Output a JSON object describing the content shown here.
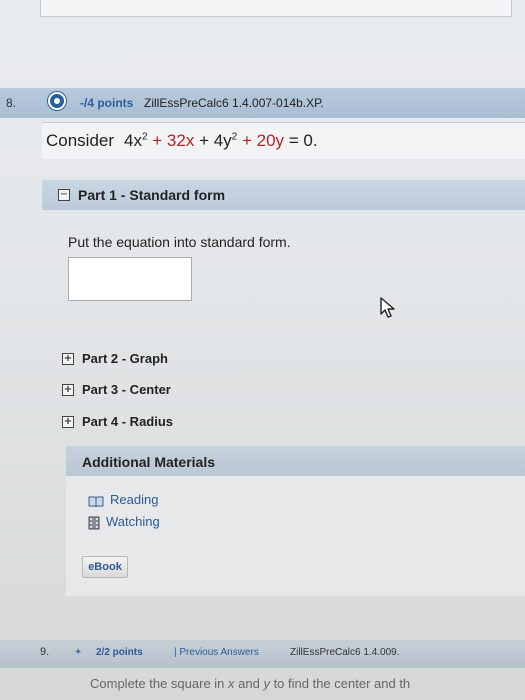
{
  "question": {
    "number": "8.",
    "points": "-/4 points",
    "problem_id": "ZillEssPreCalc6 1.4.007-014b.XP.",
    "consider_label": "Consider",
    "equation": {
      "t1": "4x",
      "t2": "+ 32x",
      "t3": "+ 4y",
      "t4": "+ 20y",
      "t5": "= 0."
    }
  },
  "part1": {
    "toggle": "−",
    "label": "Part 1 - Standard form",
    "instruction": "Put the equation into standard form.",
    "answer_value": ""
  },
  "parts": [
    {
      "toggle": "+",
      "label": "Part 2 - Graph"
    },
    {
      "toggle": "+",
      "label": "Part 3 - Center"
    },
    {
      "toggle": "+",
      "label": "Part 4 - Radius"
    }
  ],
  "additional": {
    "title": "Additional Materials",
    "links": [
      {
        "label": "Reading",
        "icon": "book-icon"
      },
      {
        "label": "Watching",
        "icon": "film-icon"
      }
    ],
    "ebook_label": "eBook"
  },
  "next_question": {
    "number": "9.",
    "points": "2/2 points",
    "previous_answers": "| Previous Answers",
    "problem_id": "ZillEssPreCalc6 1.4.009.",
    "text_start": "Complete the square in ",
    "var_x": "x",
    "text_and": " and ",
    "var_y": "y",
    "text_end": " to find the center and th"
  },
  "colors": {
    "header_blue": "#aabdd2",
    "link_blue": "#2d5b96",
    "equation_red": "#b32428"
  }
}
